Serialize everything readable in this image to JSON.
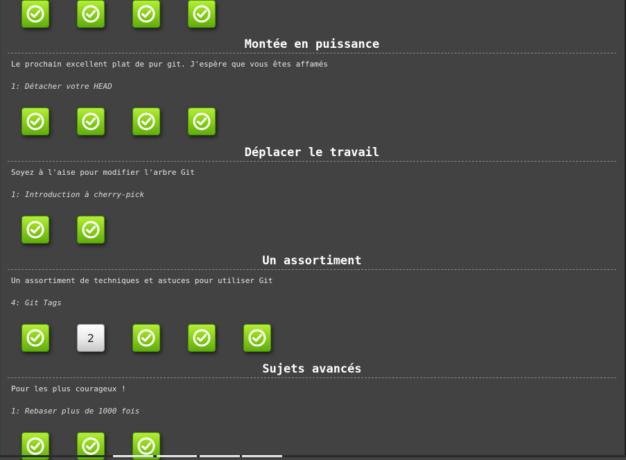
{
  "top_row": {
    "levels": [
      {
        "status": "done"
      },
      {
        "status": "done"
      },
      {
        "status": "done"
      },
      {
        "status": "done"
      }
    ]
  },
  "sections": [
    {
      "title": "Montée en puissance",
      "description": "Le prochain excellent plat de pur git. J'espère que vous êtes affamés",
      "next_level": "1: Détacher votre HEAD",
      "levels": [
        {
          "status": "done"
        },
        {
          "status": "done"
        },
        {
          "status": "done"
        },
        {
          "status": "done"
        }
      ]
    },
    {
      "title": "Déplacer le travail",
      "description": "Soyez à l'aise pour modifier l'arbre Git",
      "next_level": "1: Introduction à cherry-pick",
      "levels": [
        {
          "status": "done"
        },
        {
          "status": "done"
        }
      ]
    },
    {
      "title": "Un assortiment",
      "description": "Un assortiment de techniques et astuces pour utiliser Git",
      "next_level": "4: Git Tags",
      "levels": [
        {
          "status": "done"
        },
        {
          "status": "todo",
          "label": "2"
        },
        {
          "status": "done"
        },
        {
          "status": "done"
        },
        {
          "status": "done"
        }
      ]
    },
    {
      "title": "Sujets avancés",
      "description": "Pour les plus courageux !",
      "next_level": "1: Rebaser plus de 1000 fois",
      "levels": [
        {
          "status": "done"
        },
        {
          "status": "done"
        },
        {
          "status": "done"
        }
      ]
    }
  ],
  "icons": {
    "done": "check-circle-icon"
  },
  "colors": {
    "background": "#424242",
    "done_green": "#8bd316",
    "title": "#ffffff"
  }
}
